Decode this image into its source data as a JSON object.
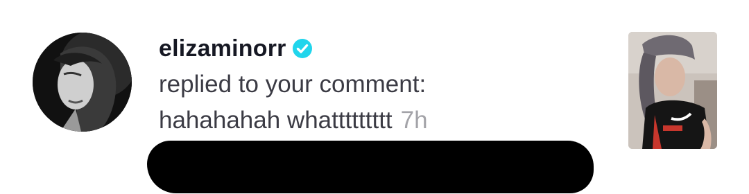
{
  "notification": {
    "username": "elizaminorr",
    "verified_icon": "verified-badge-icon",
    "action_text": "replied to your comment:",
    "reply_text": "hahahahah whattttttttt",
    "timestamp": "7h",
    "avatar_icon": "profile-avatar",
    "thumbnail_icon": "video-thumbnail",
    "colors": {
      "verified": "#20d5ec",
      "timestamp": "#a3a3a8",
      "username": "#161823"
    }
  }
}
